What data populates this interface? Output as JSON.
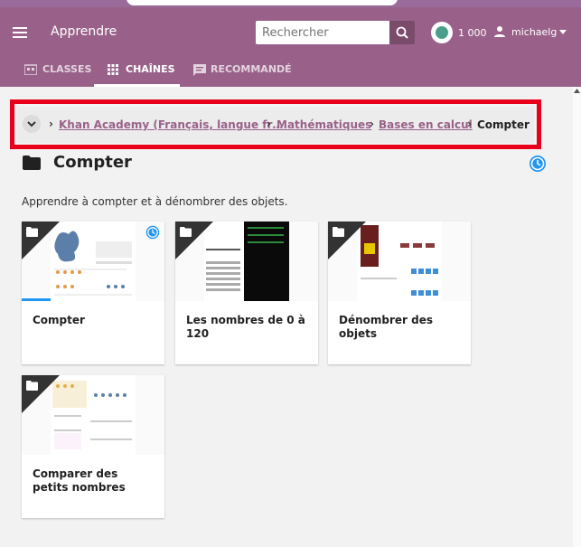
{
  "app": {
    "title": "Apprendre"
  },
  "search": {
    "placeholder": "Rechercher"
  },
  "user": {
    "points": "1 000",
    "username": "michaelg"
  },
  "tabs": [
    {
      "label": "CLASSES",
      "icon": "classes-icon"
    },
    {
      "label": "CHAÎNES",
      "icon": "channels-grid-icon",
      "active": true
    },
    {
      "label": "RECOMMANDÉ",
      "icon": "recommended-icon"
    }
  ],
  "breadcrumb": {
    "items": [
      {
        "label": "Khan Academy (Français, langue fr…"
      },
      {
        "label": "Mathématiques"
      },
      {
        "label": "Bases en calcul"
      }
    ],
    "current": "Compter"
  },
  "page": {
    "title": "Compter",
    "description": "Apprendre à compter et à dénombrer des objets."
  },
  "cards": [
    {
      "title": "Compter",
      "icon": "folder-icon",
      "progress": 0.2,
      "status": "in-progress"
    },
    {
      "title": "Les nombres de 0 à 120",
      "icon": "folder-icon"
    },
    {
      "title": "Dénombrer des objets",
      "icon": "folder-icon"
    },
    {
      "title": "Comparer des petits nombres",
      "icon": "folder-icon"
    }
  ],
  "colors": {
    "header": "#996189",
    "accent": "#996189",
    "highlight": "#e8001a",
    "progress": "#2196f3"
  }
}
